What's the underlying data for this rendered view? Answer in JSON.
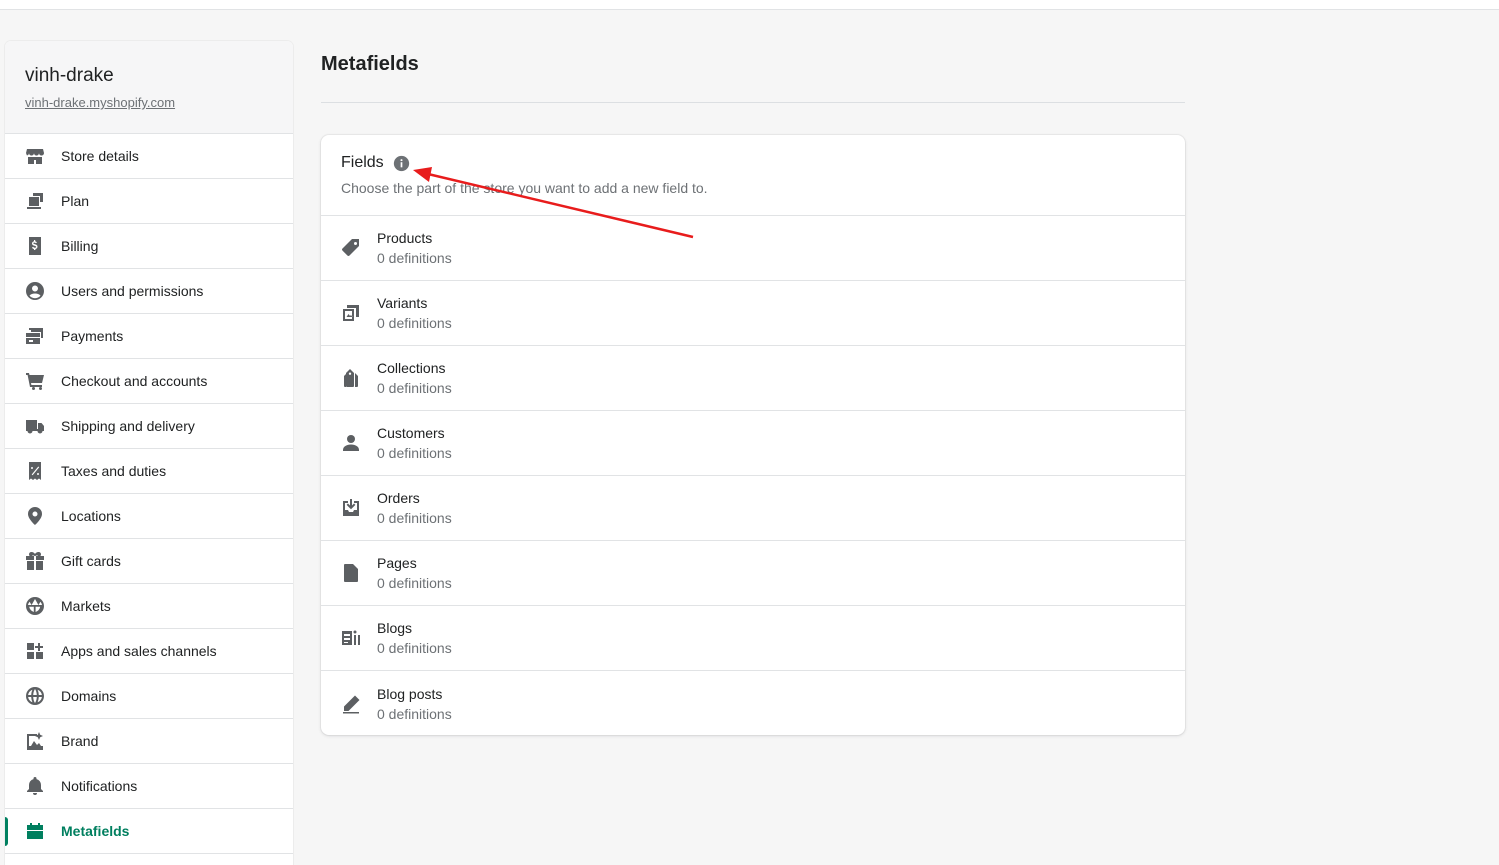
{
  "store": {
    "name": "vinh-drake",
    "url": "vinh-drake.myshopify.com"
  },
  "sidebar": {
    "items": [
      {
        "label": "Store details",
        "icon": "store-icon"
      },
      {
        "label": "Plan",
        "icon": "plan-icon"
      },
      {
        "label": "Billing",
        "icon": "billing-icon"
      },
      {
        "label": "Users and permissions",
        "icon": "user-circle-icon"
      },
      {
        "label": "Payments",
        "icon": "payments-icon"
      },
      {
        "label": "Checkout and accounts",
        "icon": "cart-icon"
      },
      {
        "label": "Shipping and delivery",
        "icon": "truck-icon"
      },
      {
        "label": "Taxes and duties",
        "icon": "tax-icon"
      },
      {
        "label": "Locations",
        "icon": "location-pin-icon"
      },
      {
        "label": "Gift cards",
        "icon": "gift-icon"
      },
      {
        "label": "Markets",
        "icon": "markets-icon"
      },
      {
        "label": "Apps and sales channels",
        "icon": "apps-icon"
      },
      {
        "label": "Domains",
        "icon": "globe-icon"
      },
      {
        "label": "Brand",
        "icon": "brand-icon"
      },
      {
        "label": "Notifications",
        "icon": "bell-icon"
      },
      {
        "label": "Metafields",
        "icon": "metafields-icon",
        "active": true
      }
    ]
  },
  "main": {
    "title": "Metafields",
    "card": {
      "title": "Fields",
      "subtitle": "Choose the part of the store you want to add a new field to.",
      "rows": [
        {
          "title": "Products",
          "sub": "0 definitions",
          "icon": "tag-icon"
        },
        {
          "title": "Variants",
          "sub": "0 definitions",
          "icon": "variants-icon"
        },
        {
          "title": "Collections",
          "sub": "0 definitions",
          "icon": "collections-icon"
        },
        {
          "title": "Customers",
          "sub": "0 definitions",
          "icon": "customer-icon"
        },
        {
          "title": "Orders",
          "sub": "0 definitions",
          "icon": "orders-icon"
        },
        {
          "title": "Pages",
          "sub": "0 definitions",
          "icon": "page-icon"
        },
        {
          "title": "Blogs",
          "sub": "0 definitions",
          "icon": "blog-icon"
        },
        {
          "title": "Blog posts",
          "sub": "0 definitions",
          "icon": "pencil-icon"
        }
      ]
    }
  },
  "colors": {
    "accent": "#008060",
    "annotation_arrow": "#e81c1c"
  }
}
